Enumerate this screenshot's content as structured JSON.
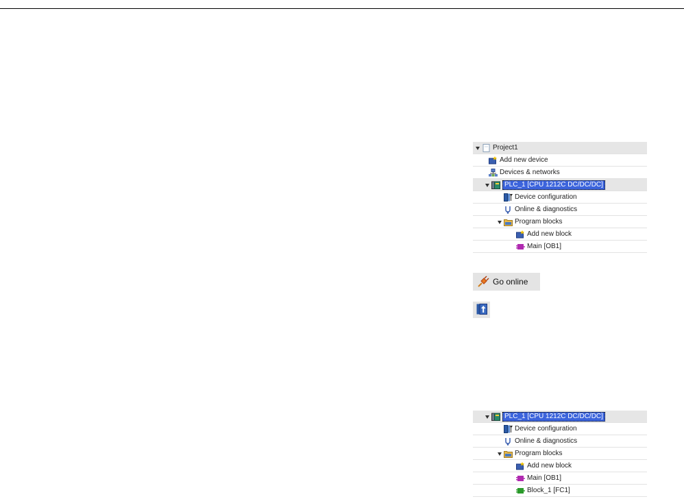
{
  "tree_top": {
    "items": [
      {
        "label": "Project1",
        "icon": "project-icon"
      },
      {
        "label": "Add new device",
        "icon": "add-device-icon"
      },
      {
        "label": "Devices & networks",
        "icon": "network-icon"
      },
      {
        "label": "PLC_1 [CPU 1212C DC/DC/DC]",
        "icon": "plc-icon"
      },
      {
        "label": "Device configuration",
        "icon": "device-config-icon"
      },
      {
        "label": "Online & diagnostics",
        "icon": "diagnostics-icon"
      },
      {
        "label": "Program blocks",
        "icon": "folder-icon"
      },
      {
        "label": "Add new block",
        "icon": "add-block-icon"
      },
      {
        "label": "Main [OB1]",
        "icon": "ob-block-icon"
      }
    ]
  },
  "toolbar": {
    "go_online_label": "Go online",
    "go_online_icon": "plug-icon",
    "upload_icon": "upload-icon"
  },
  "tree_bottom": {
    "items": [
      {
        "label": "PLC_1 [CPU 1212C DC/DC/DC]",
        "icon": "plc-icon"
      },
      {
        "label": "Device configuration",
        "icon": "device-config-icon"
      },
      {
        "label": "Online & diagnostics",
        "icon": "diagnostics-icon"
      },
      {
        "label": "Program blocks",
        "icon": "folder-icon"
      },
      {
        "label": "Add new block",
        "icon": "add-block-icon"
      },
      {
        "label": "Main [OB1]",
        "icon": "ob-block-icon"
      },
      {
        "label": "Block_1 [FC1]",
        "icon": "fc-block-icon"
      }
    ]
  },
  "colors": {
    "selection": "#3c64dc",
    "ob_block": "#b02ab0",
    "fc_block": "#2a9a2a"
  }
}
